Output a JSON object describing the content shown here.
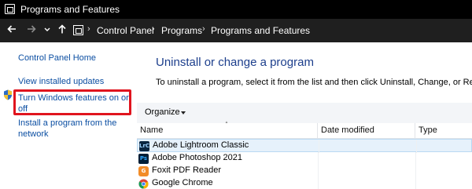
{
  "window": {
    "title": "Programs and Features"
  },
  "address_bar": {
    "back_icon": "arrow-left",
    "forward_icon": "arrow-right",
    "recent_icon": "chevron-down",
    "up_icon": "arrow-up",
    "breadcrumbs": [
      "Control Panel",
      "Programs",
      "Programs and Features"
    ]
  },
  "left_pane": {
    "control_panel_home": "Control Panel Home",
    "view_installed_updates": "View installed updates",
    "turn_windows_features_line1": "Turn Windows features on or",
    "turn_windows_features_line2": "off",
    "install_from_network_line1": "Install a program from the",
    "install_from_network_line2": "network"
  },
  "main": {
    "title": "Uninstall or change a program",
    "description": "To uninstall a program, select it from the list and then click Uninstall, Change, or Repair.",
    "organize_label": "Organize"
  },
  "columns": [
    "Name",
    "Date modified",
    "Type"
  ],
  "programs": [
    {
      "name": "Adobe Lightroom Classic",
      "icon": "lightroom-icon",
      "icon_text": "LrC",
      "icon_color": "#0a2540",
      "selected": true
    },
    {
      "name": "Adobe Photoshop 2021",
      "icon": "photoshop-icon",
      "icon_text": "Ps",
      "icon_color": "#001e36",
      "selected": false
    },
    {
      "name": "Foxit PDF Reader",
      "icon": "foxit-icon",
      "icon_text": "G",
      "icon_color": "#f28c28",
      "selected": false
    },
    {
      "name": "Google Chrome",
      "icon": "chrome-icon",
      "icon_text": "",
      "icon_color": "#4285f4",
      "selected": false
    }
  ],
  "colors": {
    "highlight_box": "#e0141e",
    "link": "#0b4ea2",
    "heading": "#1c3e8c",
    "selection": "#e6f1fb"
  }
}
